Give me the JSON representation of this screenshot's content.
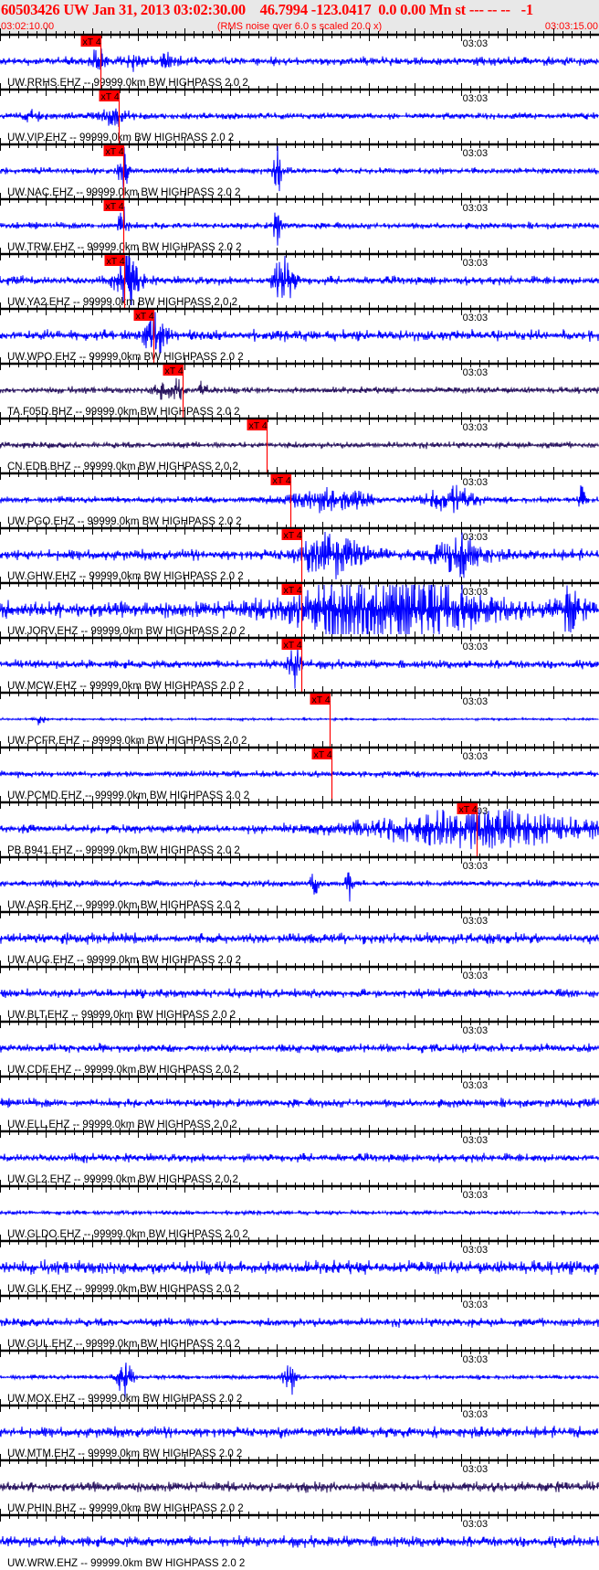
{
  "header": {
    "title": "60503426 UW Jan 31, 2013 03:02:30.00    46.7994 -123.0417  0.0 0.00 Mn st --- -- --   -1",
    "start_time": "03:02:10.00",
    "end_time": "03:03:15.00",
    "note": "(RMS noise over 6.0 s scaled 20.0 x)"
  },
  "colors": {
    "trace": "#0000ff",
    "trace_broadband": "#2a1560",
    "pick": "#ff0000",
    "axis": "#000000",
    "header_bg": "#e8e8e8"
  },
  "chart_data": {
    "type": "line",
    "title": "",
    "x_axis": {
      "start": "03:02:10.00",
      "end": "03:03:15.00",
      "tick_label": "03:03",
      "tick_label_time": "03:03:00"
    },
    "pick_label": "xT 4",
    "traces": [
      {
        "label": "UW.RRHS.EHZ -- 99999.0km BW  HIGHPASS  2.0  2",
        "color": "trace",
        "noise": 4,
        "pick": "03:02:20.9",
        "events": [
          [
            "03:02:20.6",
            14,
            0.8
          ],
          [
            "03:02:24.5",
            7,
            1
          ],
          [
            "03:02:28.0",
            6,
            1
          ]
        ]
      },
      {
        "label": "UW.VIP.EHZ -- 99999.0km BW  HIGHPASS  2.0  2",
        "color": "trace",
        "noise": 3,
        "pick": "03:02:22.9",
        "events": [
          [
            "03:02:22.5",
            9,
            1.5
          ],
          [
            "03:02:13.5",
            5,
            1
          ]
        ]
      },
      {
        "label": "UW.NAC.EHZ -- 99999.0km BW  HIGHPASS  2.0  2",
        "color": "trace",
        "noise": 3,
        "pick": "03:02:23.4",
        "events": [
          [
            "03:02:23.4",
            25,
            0.5
          ],
          [
            "03:02:40.1",
            28,
            0.4
          ]
        ]
      },
      {
        "label": "UW.TRW.EHZ -- 99999.0km BW  HIGHPASS  2.0  2",
        "color": "trace",
        "noise": 3,
        "pick": "03:02:23.4",
        "events": [
          [
            "03:02:23.4",
            22,
            0.5
          ],
          [
            "03:02:40.1",
            24,
            0.4
          ]
        ]
      },
      {
        "label": "UW.YA2.EHZ -- 99999.0km BW  HIGHPASS  2.0  2",
        "color": "trace",
        "noise": 4,
        "pick": "03:02:23.5",
        "events": [
          [
            "03:02:24.0",
            30,
            1.2
          ],
          [
            "03:02:40.8",
            30,
            1.0
          ]
        ]
      },
      {
        "label": "UW.WPO.EHZ -- 99999.0km BW  HIGHPASS  2.0  2",
        "color": "trace",
        "noise": 5,
        "pick": "03:02:26.6",
        "events": [
          [
            "03:02:26.8",
            20,
            1.2
          ]
        ]
      },
      {
        "label": "TA.F05D.BHZ -- 99999.0km BW  HIGHPASS  2.0  2",
        "color": "trace_broadband",
        "noise": 3,
        "pick": "03:02:29.8",
        "events": [
          [
            "03:02:27.3",
            9,
            0.6
          ],
          [
            "03:02:29.0",
            15,
            0.7
          ],
          [
            "03:02:32.0",
            10,
            0.5
          ]
        ]
      },
      {
        "label": "CN.EDB.BHZ -- 99999.0km BW  HIGHPASS  2.0  2",
        "color": "trace_broadband",
        "noise": 3,
        "pick": "03:02:38.9",
        "events": []
      },
      {
        "label": "UW.PGO.EHZ -- 99999.0km BW  HIGHPASS  2.0  2",
        "color": "trace",
        "noise": 3,
        "pick": "03:02:41.5",
        "events": [
          [
            "03:02:46.0",
            12,
            4
          ],
          [
            "03:02:59.0",
            14,
            2.5
          ],
          [
            "03:03:13.1",
            22,
            0.3
          ]
        ]
      },
      {
        "label": "UW.GHW.EHZ -- 99999.0km BW  HIGHPASS  2.0  2",
        "color": "trace",
        "noise": 5,
        "pick": "03:02:42.7",
        "events": [
          [
            "03:02:46.0",
            24,
            3
          ],
          [
            "03:02:59.8",
            20,
            2.5
          ]
        ]
      },
      {
        "label": "UW.JORV.EHZ -- 99999.0km BW  HIGHPASS  2.0  2",
        "color": "trace",
        "noise": 8,
        "pick": "03:02:42.7",
        "events": [
          [
            "03:02:52.0",
            40,
            9
          ],
          [
            "03:03:11.7",
            22,
            1.2
          ]
        ]
      },
      {
        "label": "UW.MCW.EHZ -- 99999.0km BW  HIGHPASS  2.0  2",
        "color": "trace",
        "noise": 4,
        "pick": "03:02:42.7",
        "events": [
          [
            "03:02:42.0",
            26,
            0.6
          ]
        ]
      },
      {
        "label": "UW.PCFR.EHZ -- 99999.0km BW  HIGHPASS  2.0  2",
        "color": "trace",
        "noise": 1,
        "pick": "03:02:45.8",
        "events": [
          [
            "03:02:14.3",
            6,
            0.6
          ]
        ]
      },
      {
        "label": "UW.PCMD.EHZ -- 99999.0km BW  HIGHPASS  2.0  2",
        "color": "trace",
        "noise": 3,
        "pick": "03:02:46.0",
        "events": []
      },
      {
        "label": "PB.B941.EHZ -- 99999.0km BW  HIGHPASS  2.0  2",
        "color": "trace",
        "noise": 4,
        "pick": "03:03:01.7",
        "events": [
          [
            "03:03:02.0",
            18,
            12
          ]
        ]
      },
      {
        "label": "UW.ASR.EHZ -- 99999.0km BW  HIGHPASS  2.0  2",
        "color": "trace",
        "noise": 3,
        "pick": null,
        "events": [
          [
            "03:02:44.1",
            16,
            0.4
          ],
          [
            "03:02:47.9",
            18,
            0.4
          ]
        ]
      },
      {
        "label": "UW.AUG.EHZ -- 99999.0km BW  HIGHPASS  2.0  2",
        "color": "trace",
        "noise": 5,
        "pick": null,
        "events": []
      },
      {
        "label": "UW.BLT.EHZ -- 99999.0km BW  HIGHPASS  2.0  2",
        "color": "trace",
        "noise": 4,
        "pick": null,
        "events": []
      },
      {
        "label": "UW.CDF.EHZ -- 99999.0km BW  HIGHPASS  2.0  2",
        "color": "trace",
        "noise": 4,
        "pick": null,
        "events": []
      },
      {
        "label": "UW.ELL.EHZ -- 99999.0km BW  HIGHPASS  2.0  2",
        "color": "trace",
        "noise": 4,
        "pick": null,
        "events": []
      },
      {
        "label": "UW.GL2.EHZ -- 99999.0km BW  HIGHPASS  2.0  2",
        "color": "trace",
        "noise": 4,
        "pick": null,
        "events": []
      },
      {
        "label": "UW.GLDO.EHZ -- 99999.0km BW  HIGHPASS  2.0  2",
        "color": "trace",
        "noise": 2,
        "pick": null,
        "events": []
      },
      {
        "label": "UW.GLK.EHZ -- 99999.0km BW  HIGHPASS  2.0  2",
        "color": "trace",
        "noise": 6,
        "pick": null,
        "events": []
      },
      {
        "label": "UW.GUL.EHZ -- 99999.0km BW  HIGHPASS  2.0  2",
        "color": "trace",
        "noise": 4,
        "pick": null,
        "events": []
      },
      {
        "label": "UW.MOX.EHZ -- 99999.0km BW  HIGHPASS  2.0  2",
        "color": "trace",
        "noise": 2,
        "pick": null,
        "events": [
          [
            "03:02:23.5",
            22,
            0.8
          ],
          [
            "03:02:41.4",
            22,
            0.6
          ]
        ]
      },
      {
        "label": "UW.MTM.EHZ -- 99999.0km BW  HIGHPASS  2.0  2",
        "color": "trace",
        "noise": 5,
        "pick": null,
        "events": []
      },
      {
        "label": "UW.PHIN.BHZ -- 99999.0km BW  HIGHPASS  2.0  2",
        "color": "trace_broadband",
        "noise": 5,
        "pick": null,
        "events": []
      },
      {
        "label": "UW.WRW.EHZ -- 99999.0km BW  HIGHPASS  2.0  2",
        "color": "trace",
        "noise": 5,
        "pick": null,
        "events": []
      }
    ]
  }
}
